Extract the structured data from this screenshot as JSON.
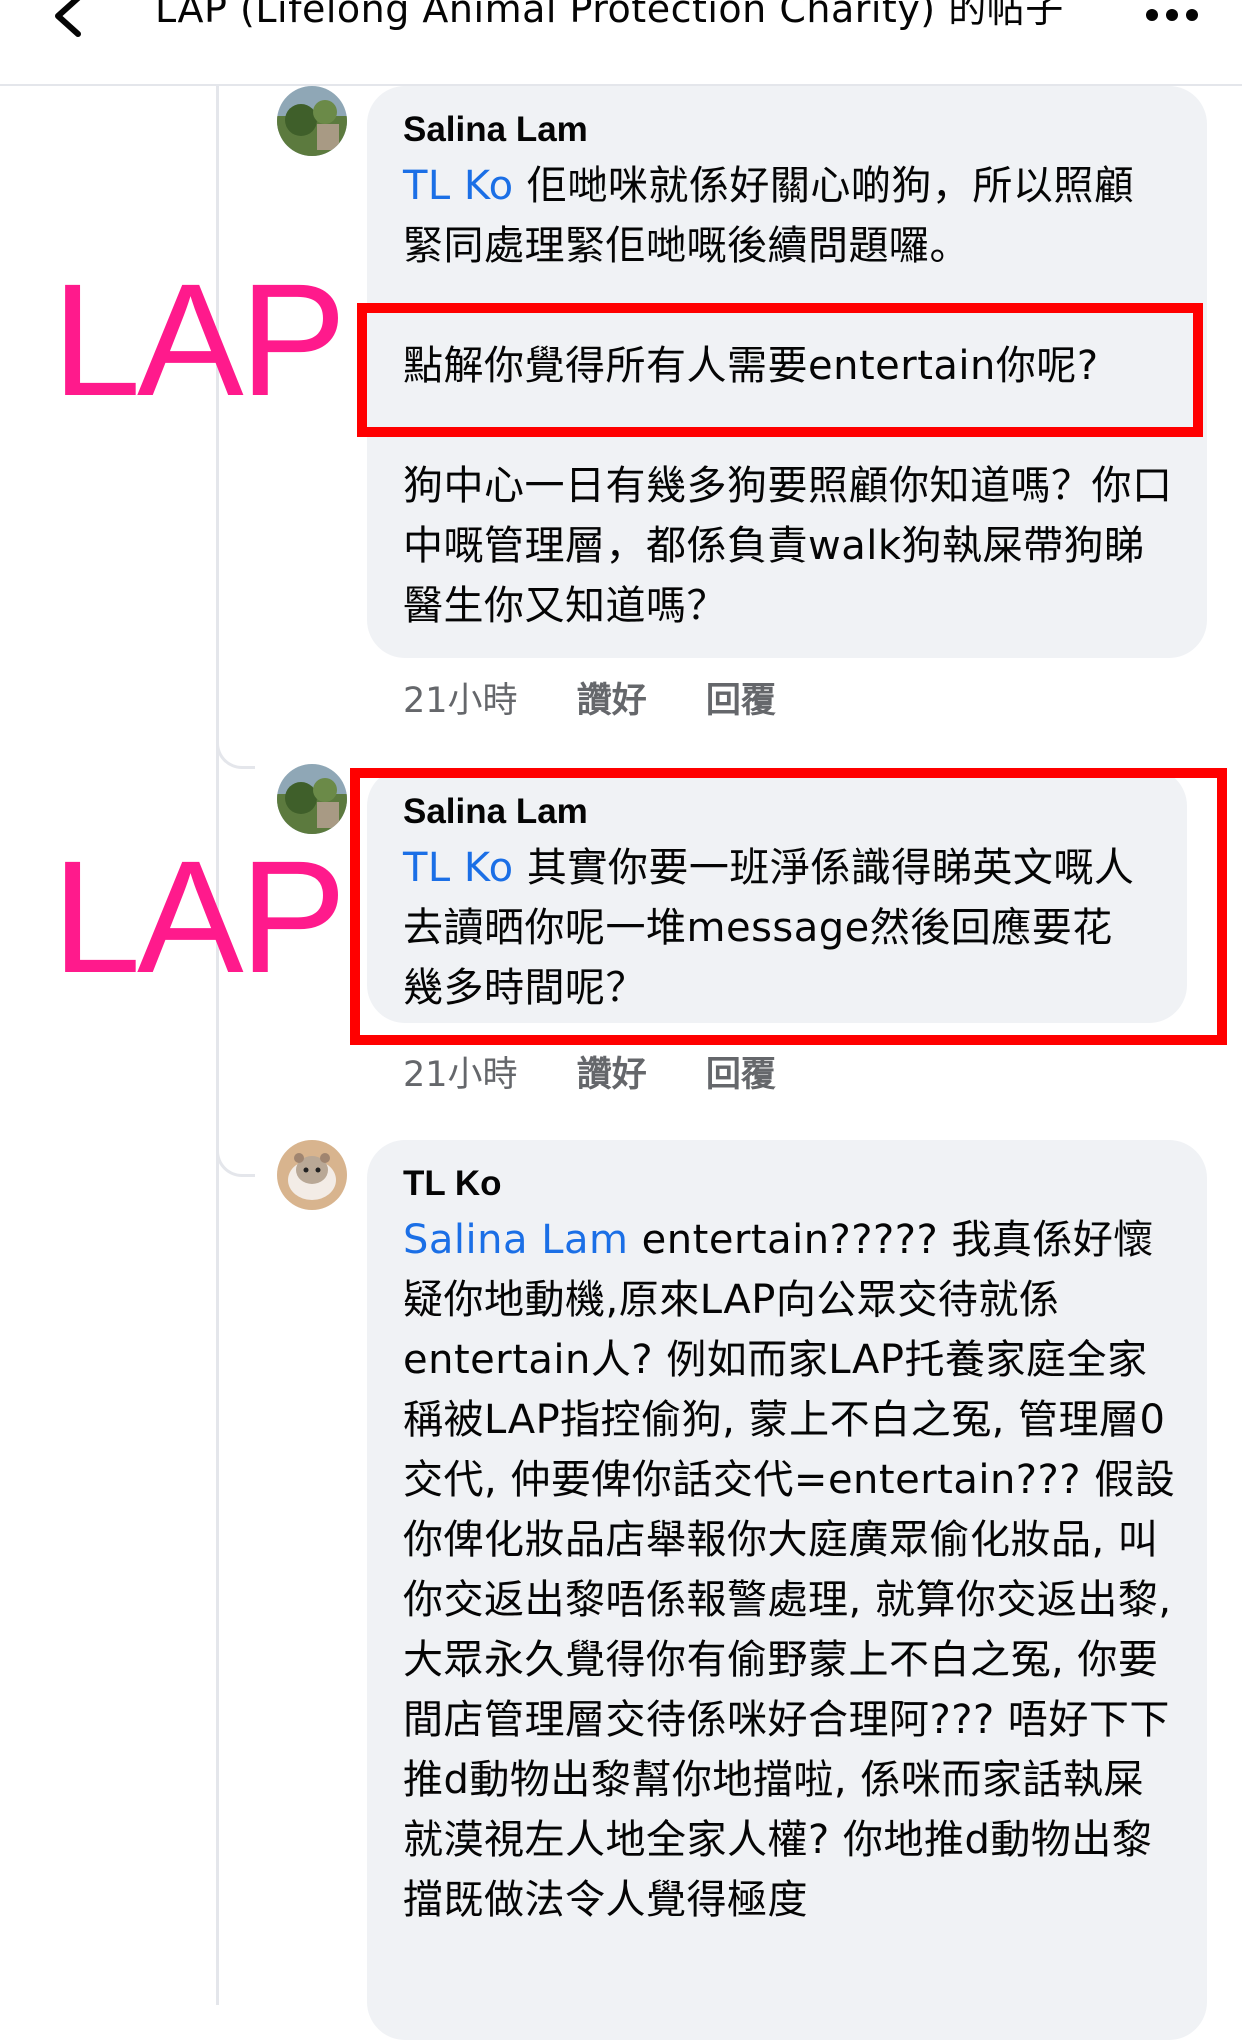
{
  "header": {
    "title": "LAP (Lifelong Animal Protection Charity) 的帖子"
  },
  "annotations": {
    "label_1": "LAP",
    "label_2": "LAP",
    "highlight_color": "#ff0000",
    "label_color": "#ff1a8c"
  },
  "comments": [
    {
      "author": "Salina Lam",
      "mention": "TL Ko",
      "text_1": " 佢哋咪就係好關心啲狗，所以照顧緊同處理緊佢哋嘅後續問題囉。",
      "text_2": "點解你覺得所有人需要entertain你呢?",
      "text_3": "狗中心一日有幾多狗要照顧你知道嗎？你口中嘅管理層，都係負責walk狗執屎帶狗睇醫生你又知道嗎？",
      "time": "21小時",
      "like_label": "讚好",
      "reply_label": "回覆"
    },
    {
      "author": "Salina Lam",
      "mention": "TL Ko",
      "text": " 其實你要一班淨係識得睇英文嘅人去讀晒你呢一堆message然後回應要花幾多時間呢？",
      "time": "21小時",
      "like_label": "讚好",
      "reply_label": "回覆"
    },
    {
      "author": "TL Ko",
      "mention": "Salina Lam",
      "text": " entertain????? 我真係好懷疑你地動機,原來LAP向公眾交待就係entertain人? 例如而家LAP托養家庭全家稱被LAP指控偷狗, 蒙上不白之冤, 管理層0交代, 仲要俾你話交代=entertain??? 假設你俾化妝品店舉報你大庭廣眾偷化妝品, 叫你交返出黎唔係報警處理, 就算你交返出黎, 大眾永久覺得你有偷野蒙上不白之冤, 你要間店管理層交待係咪好合理阿??? 唔好下下推d動物出黎幫你地擋啦, 係咪而家話執屎就漠視左人地全家人權? 你地推d動物出黎擋既做法令人覺得極度"
    }
  ]
}
